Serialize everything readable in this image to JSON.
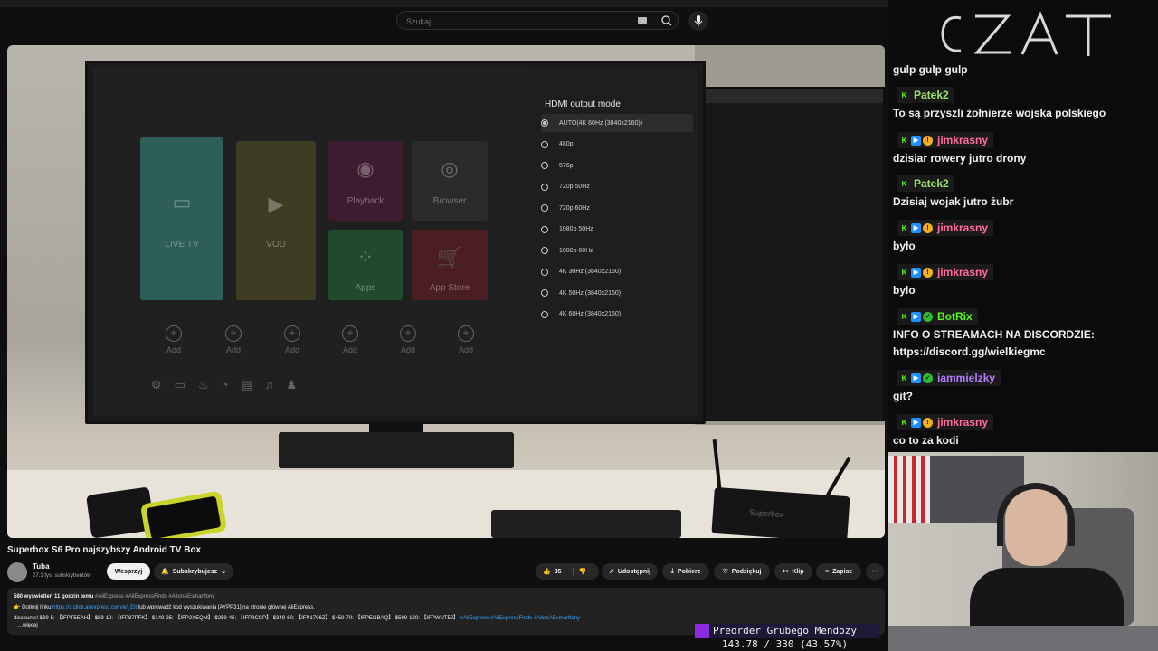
{
  "search": {
    "placeholder": "Szukaj"
  },
  "tv_menu": {
    "tiles": [
      "LIVE TV",
      "VOD",
      "Playback",
      "Browser",
      "Apps",
      "App Store"
    ],
    "add_label": "Add",
    "hdmi_title": "HDMI output mode",
    "hdmi_options": [
      "AUTO(4K 60Hz (3840x2160))",
      "480p",
      "576p",
      "720p 50Hz",
      "720p 60Hz",
      "1080p 50Hz",
      "1080p 60Hz",
      "4K 30Hz (3840x2160)",
      "4K 50Hz (3840x2160)",
      "4K 60Hz (3840x2160)"
    ],
    "hdmi_selected": 0,
    "box_logo": "Superbox"
  },
  "video": {
    "title": "Superbox S6 Pro najszybszy Android TV Box",
    "channel_name": "Tuba",
    "channel_subs": "27,1 tys. subskrybentów",
    "support_label": "Wesprzyj",
    "subscribe_label": "Subskrybujesz",
    "actions": {
      "likes": "35",
      "share": "Udostępnij",
      "download": "Pobierz",
      "thanks": "Podziękuj",
      "clip": "Klip",
      "save": "Zapisz"
    },
    "description": {
      "views": "580 wyświetleń  11 godzin temu",
      "tags": "#AliExpress #AliExpressFinds #AllonAEsmartfony",
      "line2_prefix": "👉 Dotknij linku ",
      "line2_link": "https://s.click.aliexpress.com/e/_Elt",
      "line2_suffix": " lub wprowadź kod wyszukiwania [AYPP31] na stronie głównej AliExpress,",
      "line3": "discounts! $39-5: 【IFPT5EAH】 $89-10: 【IFP87PFK】 $149-25: 【IFP2XEQM】 $259-45: 【IFP9CCP】 $349-60: 【IFP1706Z】 $459-70: 【IFPEGBAQ】 $599-120: 【IFPWUT5J】 ",
      "line3_tags": "#AliExpress #AliExpressFinds #AllonAEsmartfony",
      "more": "...więcej"
    }
  },
  "chat": {
    "first_message": "gulp gulp gulp",
    "messages": [
      {
        "user": "Patek2",
        "color": "#9be36b",
        "badges": [
          "k"
        ],
        "text": "To są przyszli żołnierze wojska polskiego"
      },
      {
        "user": "jimkrasny",
        "color": "#ff6b9d",
        "badges": [
          "k",
          "sq",
          "coin"
        ],
        "text": "dzisiar rowery jutro drony"
      },
      {
        "user": "Patek2",
        "color": "#9be36b",
        "badges": [
          "k"
        ],
        "text": "Dzisiaj wojak jutro żubr"
      },
      {
        "user": "jimkrasny",
        "color": "#ff6b9d",
        "badges": [
          "k",
          "sq",
          "coin"
        ],
        "text": "było"
      },
      {
        "user": "jimkrasny",
        "color": "#ff6b9d",
        "badges": [
          "k",
          "sq",
          "coin"
        ],
        "text": "bylo"
      },
      {
        "user": "BotRix",
        "color": "#53fc18",
        "badges": [
          "k",
          "sq",
          "ok"
        ],
        "text": "INFO O STREAMACH NA DISCORDZIE:",
        "text2": "https://discord.gg/wielkiegmc"
      },
      {
        "user": "iammielzky",
        "color": "#b57bff",
        "badges": [
          "k",
          "sq",
          "ok"
        ],
        "text": "git?"
      },
      {
        "user": "jimkrasny",
        "color": "#ff6b9d",
        "badges": [
          "k",
          "sq",
          "coin"
        ],
        "text": "co to za kodi"
      }
    ]
  },
  "overlay": {
    "title": "Preorder Grubego Mendozy",
    "progress_text": "143.78 / 330 (43.57%)"
  },
  "colors": {
    "accent": "#53fc18",
    "link": "#3ea6ff"
  }
}
